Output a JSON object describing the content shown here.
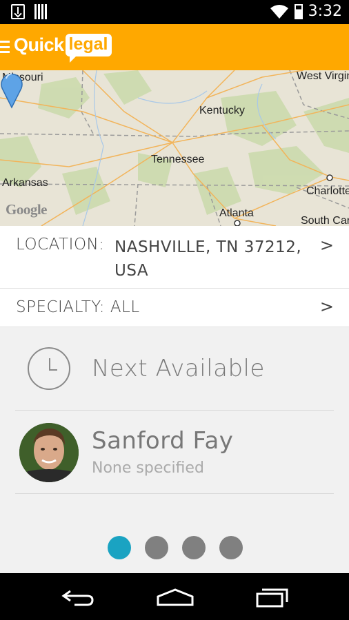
{
  "status_bar": {
    "time": "3:32",
    "icons": [
      "download-icon",
      "storage-icon",
      "wifi-icon",
      "battery-icon"
    ]
  },
  "app_bar": {
    "logo_quick": "Quick",
    "logo_legal": "legal",
    "menu_icon": "hamburger-menu-icon",
    "color": "#ffa800"
  },
  "map": {
    "labels": {
      "missouri": "Missouri",
      "kentucky": "Kentucky",
      "west_virginia": "West Virgin",
      "tennessee": "Tennessee",
      "arkansas": "Arkansas",
      "charlotte": "Charlotte",
      "atlanta": "Atlanta",
      "south_carolina": "South Car"
    },
    "attribution": "Google"
  },
  "location": {
    "label": "LOCATION:",
    "value": "NASHVILLE, TN 37212, USA",
    "chevron": ">"
  },
  "specialty": {
    "text": "SPECIALTY: ALL",
    "chevron": ">"
  },
  "next_available": {
    "label": "Next Available",
    "icon": "clock-icon"
  },
  "lawyer": {
    "name": "Sanford Fay",
    "specialty": "None specified"
  },
  "pagination": {
    "total": 4,
    "active_index": 0,
    "active_color": "#1aa3c2"
  },
  "navbar": {
    "buttons": [
      "back-icon",
      "home-icon",
      "recents-icon"
    ]
  }
}
